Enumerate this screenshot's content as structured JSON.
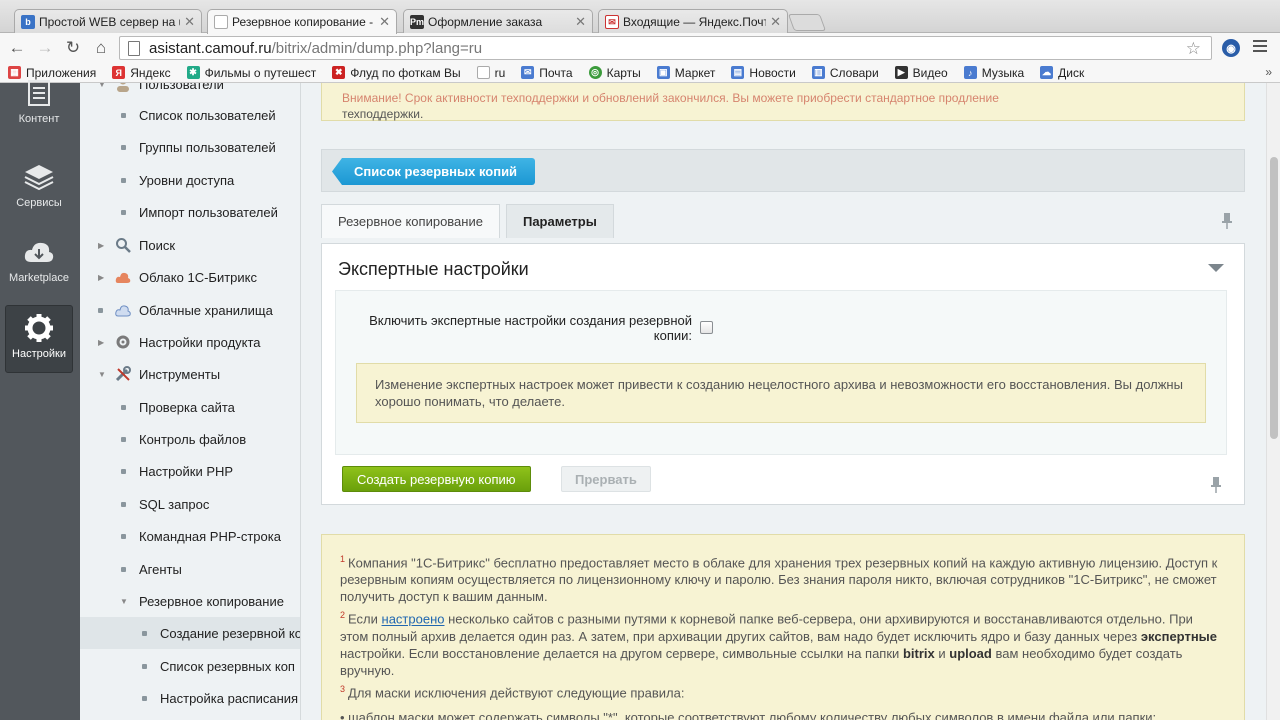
{
  "browser": {
    "tabs": [
      {
        "title": "Простой WEB сервер на u",
        "favicon": "b",
        "color": "#3a73c6"
      },
      {
        "title": "Резервное копирование -",
        "favicon": "doc",
        "color": "#999999"
      },
      {
        "title": "Оформление заказа",
        "favicon": "Pm",
        "color": "#333333"
      },
      {
        "title": "Входящие — Яндекс.Почт",
        "favicon": "mail",
        "color": "#c33"
      }
    ],
    "url_host": "asistant.camouf.ru",
    "url_path": "/bitrix/admin/dump.php?lang=ru",
    "bookmarks": [
      {
        "label": "Приложения",
        "icon": "apps-icon",
        "color": "#d44"
      },
      {
        "label": "Яндекс",
        "icon": "yandex-icon",
        "color": "#d33"
      },
      {
        "label": "Фильмы о путешест",
        "icon": "film-icon",
        "color": "#2a8"
      },
      {
        "label": "Флуд по фоткам Вы",
        "icon": "flood-icon",
        "color": "#c22"
      },
      {
        "label": "ru",
        "icon": "doc-icon",
        "color": "#aaa"
      },
      {
        "label": "Почта",
        "icon": "mail-icon",
        "color": "#4a7bd0"
      },
      {
        "label": "Карты",
        "icon": "maps-icon",
        "color": "#3b9b3b"
      },
      {
        "label": "Маркет",
        "icon": "market-icon",
        "color": "#4a7bd0"
      },
      {
        "label": "Новости",
        "icon": "news-icon",
        "color": "#4a7bd0"
      },
      {
        "label": "Словари",
        "icon": "dict-icon",
        "color": "#4a7bd0"
      },
      {
        "label": "Видео",
        "icon": "video-icon",
        "color": "#333"
      },
      {
        "label": "Музыка",
        "icon": "music-icon",
        "color": "#4a7bd0"
      },
      {
        "label": "Диск",
        "icon": "disk-icon",
        "color": "#4a7bd0"
      }
    ],
    "bookmarks_more": "»"
  },
  "leftpanel": {
    "items": [
      {
        "label": "Контент",
        "icon": "content-icon"
      },
      {
        "label": "Сервисы",
        "icon": "services-icon"
      },
      {
        "label": "Marketplace",
        "icon": "marketplace-icon"
      },
      {
        "label": "Настройки",
        "icon": "settings-icon",
        "active": true
      }
    ]
  },
  "tree": {
    "top_cut": "Пользователи",
    "items": [
      {
        "label": "Список пользователей",
        "type": "dot",
        "level": 1
      },
      {
        "label": "Группы пользователей",
        "type": "dot",
        "level": 1
      },
      {
        "label": "Уровни доступа",
        "type": "dot",
        "level": 1
      },
      {
        "label": "Импорт пользователей",
        "type": "dot",
        "level": 1
      },
      {
        "label": "Поиск",
        "type": "collapsed",
        "icon": "search-icon"
      },
      {
        "label": "Облако 1С-Битрикс",
        "type": "collapsed",
        "icon": "cloud-bitrix-icon"
      },
      {
        "label": "Облачные хранилища",
        "type": "dot0",
        "icon": "cloud-storage-icon"
      },
      {
        "label": "Настройки продукта",
        "type": "collapsed",
        "icon": "gear-icon"
      },
      {
        "label": "Инструменты",
        "type": "expanded",
        "icon": "tools-icon"
      },
      {
        "label": "Проверка сайта",
        "type": "dot",
        "level": 1
      },
      {
        "label": "Контроль файлов",
        "type": "dot",
        "level": 1
      },
      {
        "label": "Настройки PHP",
        "type": "dot",
        "level": 1
      },
      {
        "label": "SQL запрос",
        "type": "dot",
        "level": 1
      },
      {
        "label": "Командная PHP-строка",
        "type": "dot",
        "level": 1
      },
      {
        "label": "Агенты",
        "type": "dot",
        "level": 1
      },
      {
        "label": "Резервное копирование",
        "type": "expanded-sub",
        "level": 1
      },
      {
        "label": "Создание резервной ко",
        "type": "dot",
        "level": 2,
        "selected": true
      },
      {
        "label": "Список резервных коп",
        "type": "dot",
        "level": 2
      },
      {
        "label": "Настройка расписания",
        "type": "dot",
        "level": 2
      }
    ]
  },
  "main": {
    "notice_top_line1": "Внимание! Срок активности техподдержки и обновлений закончился. Вы можете приобрести стандартное продление",
    "notice_top_line2": "техподдержки.",
    "list_button": "Список резервных копий",
    "tabs": [
      {
        "label": "Резервное копирование",
        "active": false
      },
      {
        "label": "Параметры",
        "active": true
      }
    ],
    "panel_title": "Экспертные настройки",
    "option_label": "Включить экспертные настройки создания резервной копии:",
    "option_checked": false,
    "warning": "Изменение экспертных настроек может привести к созданию нецелостного архива и невозможности его восстановления. Вы должны хорошо понимать, что делаете.",
    "create_button": "Создать резервную копию",
    "stop_button": "Прервать",
    "notes": {
      "n1": "Компания \"1С-Битрикс\" бесплатно предоставляет место в облаке для хранения трех резервных копий на каждую активную лицензию. Доступ к резервным копиям осуществляется по лицензионному ключу и паролю. Без знания пароля никто, включая сотрудников \"1С-Битрикс\", не сможет получить доступ к вашим данным.",
      "n2_pre": "Если",
      "n2_link": "настроено",
      "n2_a": "несколько сайтов с разными путями к корневой папке веб-сервера, они архивируются и восстанавливаются отдельно. При этом полный архив делается один раз. А затем, при архивации других сайтов, вам надо будет исключить ядро и базу данных через",
      "n2_b1": "экспертные",
      "n2_c": "настройки. Если восстановление делается на другом сервере, символьные ссылки на папки",
      "n2_b2": "bitrix",
      "n2_and": "и",
      "n2_b3": "upload",
      "n2_d": "вам необходимо будет создать вручную.",
      "n3": "Для маски исключения действуют следующие правила:",
      "n3_item": "• шаблон маски может содержать символы \"*\", которые соответствуют любому количеству любых символов в имени файла или папки;"
    }
  }
}
